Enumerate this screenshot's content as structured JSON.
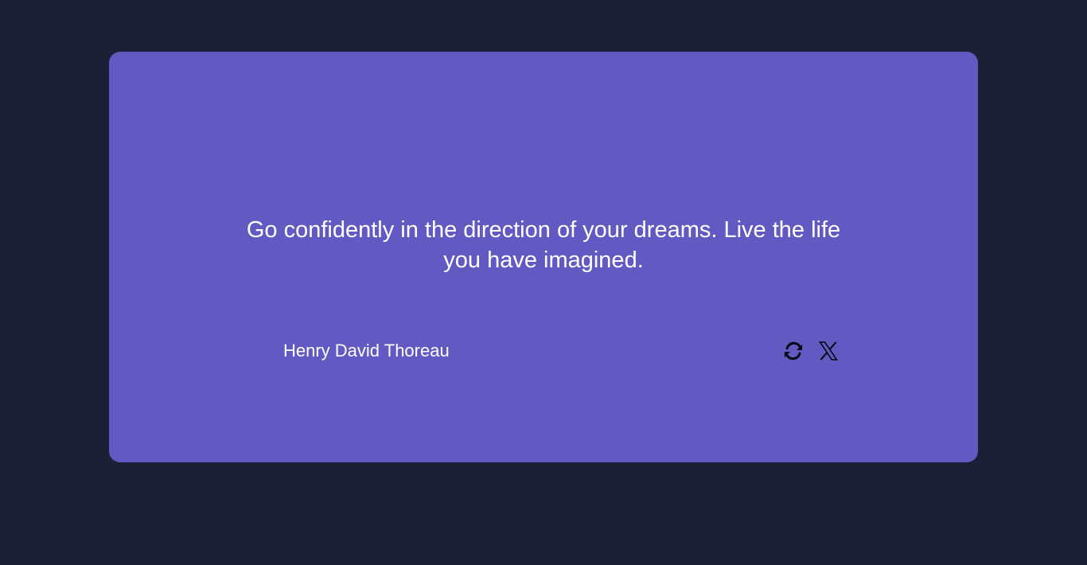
{
  "theme": {
    "page_background": "#1c2036",
    "card_background": "#6359c3",
    "text_color": "#ffffff",
    "icon_color": "#0a0a14"
  },
  "quote": {
    "text": "Go confidently in the direction of your dreams. Live the life you have imagined.",
    "author": "Henry David Thoreau"
  },
  "actions": {
    "refresh_icon": "refresh-icon",
    "share_icon": "x-logo-icon"
  }
}
